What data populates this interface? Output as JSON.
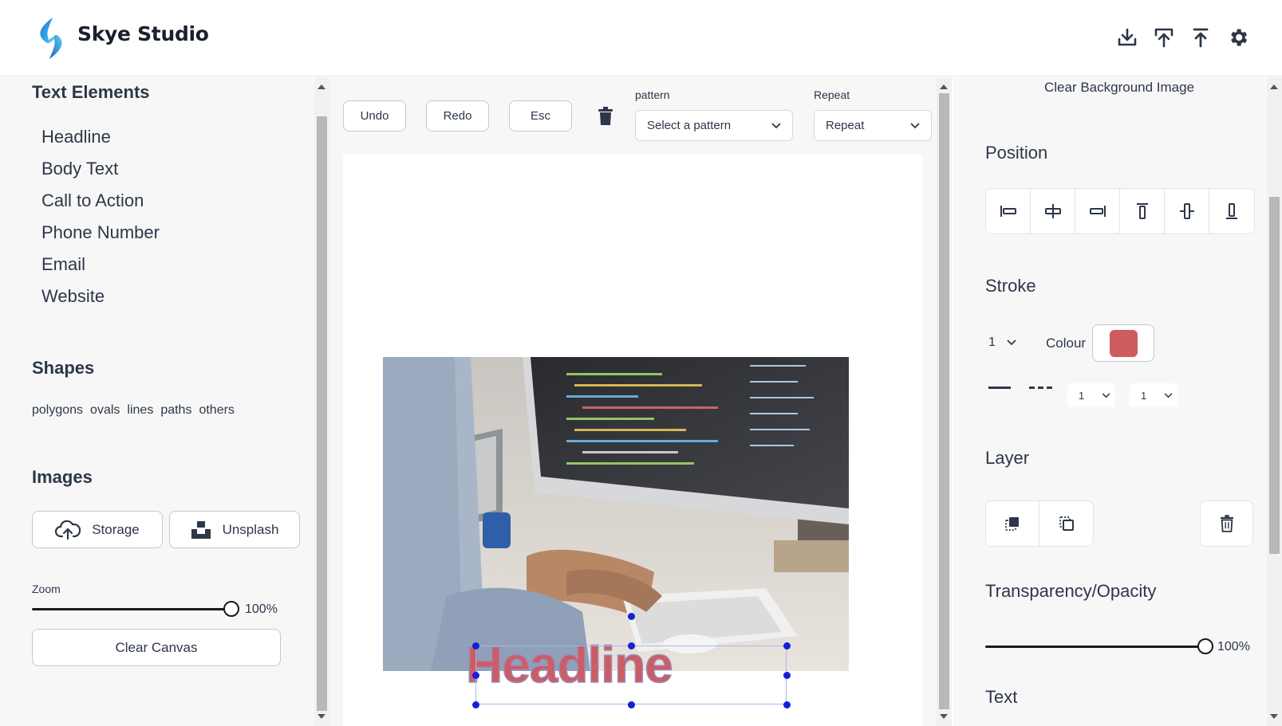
{
  "header": {
    "brand": "Skye Studio",
    "actions": [
      "download-icon",
      "upload-icon",
      "publish-icon",
      "gear-icon"
    ]
  },
  "left": {
    "text_section_title": "Text Elements",
    "text_items": [
      "Headline",
      "Body Text",
      "Call to Action",
      "Phone Number",
      "Email",
      "Website"
    ],
    "shapes_title": "Shapes",
    "shapes": [
      "polygons",
      "ovals",
      "lines",
      "paths",
      "others"
    ],
    "images_title": "Images",
    "storage_label": "Storage",
    "unsplash_label": "Unsplash",
    "zoom_label": "Zoom",
    "zoom_value": "100%",
    "zoom_fraction": 1.0,
    "clear_canvas_label": "Clear Canvas"
  },
  "toolbar": {
    "undo": "Undo",
    "redo": "Redo",
    "esc": "Esc",
    "pattern_label": "pattern",
    "pattern_placeholder": "Select a pattern",
    "repeat_label": "Repeat",
    "repeat_value": "Repeat"
  },
  "canvas": {
    "headline_text": "Headline",
    "headline_color": "#cd5c64"
  },
  "right": {
    "clear_bg_label": "Clear Background Image",
    "position_title": "Position",
    "position_buttons": [
      "align-left-icon",
      "align-center-horizontal-icon",
      "align-right-icon",
      "align-top-icon",
      "align-middle-vertical-icon",
      "align-bottom-icon"
    ],
    "stroke_title": "Stroke",
    "stroke_width": "1",
    "colour_label": "Colour",
    "stroke_colour": "#cd5c5c",
    "dash_value_1": "1",
    "dash_value_2": "1",
    "layer_title": "Layer",
    "opacity_title": "Transparency/Opacity",
    "opacity_value": "100%",
    "opacity_fraction": 1.0,
    "text_title": "Text"
  }
}
